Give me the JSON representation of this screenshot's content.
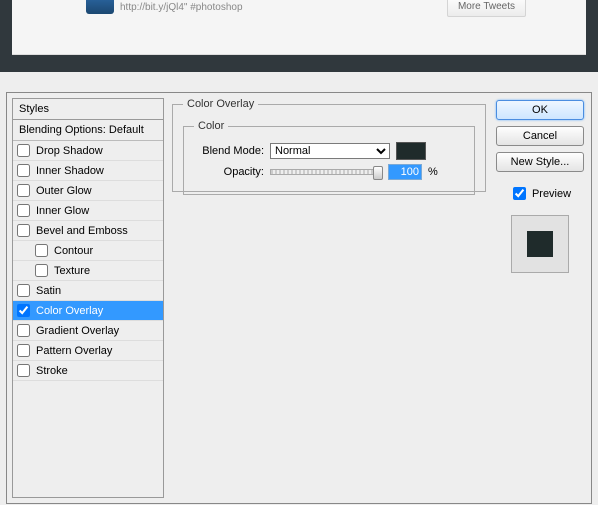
{
  "top": {
    "url_text": "http://bit.y/jQl4\" #photoshop",
    "more_tweets": "More Tweets"
  },
  "styles_panel": {
    "header": "Styles",
    "blending": "Blending Options: Default",
    "items": [
      {
        "label": "Drop Shadow",
        "checked": false,
        "sub": false,
        "selected": false
      },
      {
        "label": "Inner Shadow",
        "checked": false,
        "sub": false,
        "selected": false
      },
      {
        "label": "Outer Glow",
        "checked": false,
        "sub": false,
        "selected": false
      },
      {
        "label": "Inner Glow",
        "checked": false,
        "sub": false,
        "selected": false
      },
      {
        "label": "Bevel and Emboss",
        "checked": false,
        "sub": false,
        "selected": false
      },
      {
        "label": "Contour",
        "checked": false,
        "sub": true,
        "selected": false
      },
      {
        "label": "Texture",
        "checked": false,
        "sub": true,
        "selected": false
      },
      {
        "label": "Satin",
        "checked": false,
        "sub": false,
        "selected": false
      },
      {
        "label": "Color Overlay",
        "checked": true,
        "sub": false,
        "selected": true
      },
      {
        "label": "Gradient Overlay",
        "checked": false,
        "sub": false,
        "selected": false
      },
      {
        "label": "Pattern Overlay",
        "checked": false,
        "sub": false,
        "selected": false
      },
      {
        "label": "Stroke",
        "checked": false,
        "sub": false,
        "selected": false
      }
    ]
  },
  "center": {
    "group_title": "Color Overlay",
    "color_title": "Color",
    "blend_mode_label": "Blend Mode:",
    "blend_mode_value": "Normal",
    "swatch_color": "#1f2b2b",
    "opacity_label": "Opacity:",
    "opacity_value": "100",
    "opacity_unit": "%"
  },
  "right": {
    "ok": "OK",
    "cancel": "Cancel",
    "new_style": "New Style...",
    "preview_label": "Preview",
    "preview_checked": true,
    "preview_color": "#1f2b2b"
  }
}
